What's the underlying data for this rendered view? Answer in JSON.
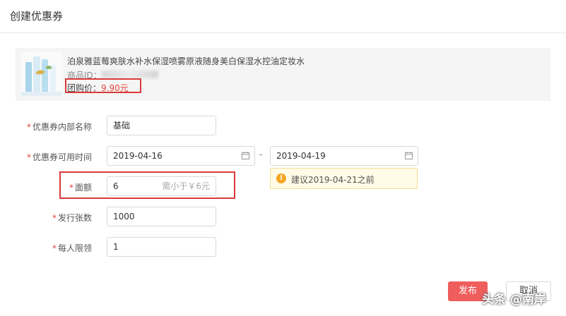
{
  "dialog": {
    "title": "创建优惠券"
  },
  "product": {
    "name": "泊泉雅蓝莓爽肤水补水保湿喷雾原液随身美白保湿水控油定妆水",
    "id_label": "商品ID：",
    "price_label": "团购价：",
    "price_value": "9.90元"
  },
  "form": {
    "internal_name": {
      "label": "优惠券内部名称",
      "value": "基础"
    },
    "valid_time": {
      "label": "优惠券可用时间",
      "start": "2019-04-16",
      "separator": "-",
      "end": "2019-04-19",
      "suggestion": "建议2019-04-21之前"
    },
    "amount": {
      "label": "面额",
      "value": "6",
      "hint": "需小于￥6元"
    },
    "issue_count": {
      "label": "发行张数",
      "value": "1000"
    },
    "per_person_limit": {
      "label": "每人限领",
      "value": "1"
    }
  },
  "actions": {
    "publish": "发布",
    "cancel": "取消"
  },
  "watermark": "头条 @南岸",
  "colors": {
    "required": "#e6453c",
    "primary_button": "#ef5d5d",
    "highlight_box": "#d93a3a",
    "warning_bg": "#fffbe6"
  }
}
